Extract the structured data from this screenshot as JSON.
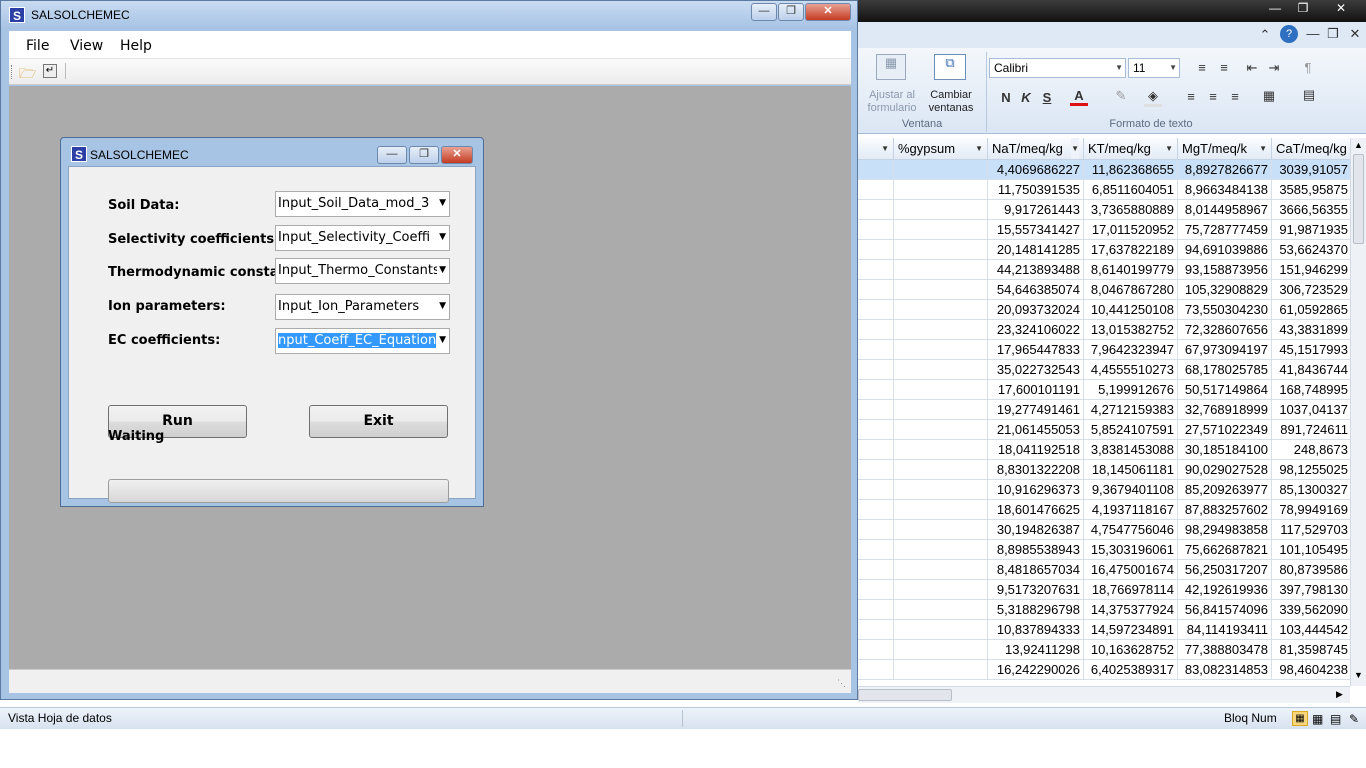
{
  "background_app": {
    "status_left": "Vista Hoja de datos",
    "status_right": "Bloq Num",
    "ribbon": {
      "ventana_group": "Ventana",
      "formato_group": "Formato de texto",
      "ajustar_label1": "Ajustar al",
      "ajustar_label2": "formulario",
      "cambiar_label1": "Cambiar",
      "cambiar_label2": "ventanas",
      "font_name": "Calibri",
      "font_size": "11",
      "bold_label": "N",
      "italic_label": "K",
      "underline_label": "S",
      "fontcolor_label": "A"
    },
    "grid": {
      "headers": [
        "%gypsum",
        "NaT/meq/kg",
        "KT/meq/kg",
        "MgT/meq/k",
        "CaT/meq/kg"
      ],
      "rows": [
        [
          "",
          "4,4069686227",
          "11,862368655",
          "8,8927826677",
          "3039,91057"
        ],
        [
          "",
          "11,750391535",
          "6,8511604051",
          "8,9663484138",
          "3585,95875"
        ],
        [
          "",
          "9,917261443",
          "3,7365880889",
          "8,0144958967",
          "3666,56355"
        ],
        [
          "",
          "15,557341427",
          "17,011520952",
          "75,728777459",
          "91,9871935"
        ],
        [
          "",
          "20,148141285",
          "17,637822189",
          "94,691039886",
          "53,6624370"
        ],
        [
          "",
          "44,213893488",
          "8,6140199779",
          "93,158873956",
          "151,946299"
        ],
        [
          "",
          "54,646385074",
          "8,0467867280",
          "105,32908829",
          "306,723529"
        ],
        [
          "",
          "20,093732024",
          "10,441250108",
          "73,550304230",
          "61,0592865"
        ],
        [
          "",
          "23,324106022",
          "13,015382752",
          "72,328607656",
          "43,3831899"
        ],
        [
          "",
          "17,965447833",
          "7,9642323947",
          "67,973094197",
          "45,1517993"
        ],
        [
          "",
          "35,022732543",
          "4,4555510273",
          "68,178025785",
          "41,8436744"
        ],
        [
          "",
          "17,600101191",
          "5,199912676",
          "50,517149864",
          "168,748995"
        ],
        [
          "",
          "19,277491461",
          "4,2712159383",
          "32,768918999",
          "1037,04137"
        ],
        [
          "",
          "21,061455053",
          "5,8524107591",
          "27,571022349",
          "891,724611"
        ],
        [
          "",
          "18,041192518",
          "3,8381453088",
          "30,185184100",
          "248,8673"
        ],
        [
          "",
          "8,8301322208",
          "18,145061181",
          "90,029027528",
          "98,1255025"
        ],
        [
          "",
          "10,916296373",
          "9,3679401108",
          "85,209263977",
          "85,1300327"
        ],
        [
          "",
          "18,601476625",
          "4,1937118167",
          "87,883257602",
          "78,9949169"
        ],
        [
          "",
          "30,194826387",
          "4,7547756046",
          "98,294983858",
          "117,529703"
        ],
        [
          "",
          "8,8985538943",
          "15,303196061",
          "75,662687821",
          "101,105495"
        ],
        [
          "",
          "8,4818657034",
          "16,475001674",
          "56,250317207",
          "80,8739586"
        ],
        [
          "",
          "9,5173207631",
          "18,766978114",
          "42,192619936",
          "397,798130"
        ],
        [
          "",
          "5,3188296798",
          "14,375377924",
          "56,841574096",
          "339,562090"
        ],
        [
          "",
          "10,837894333",
          "14,597234891",
          "84,114193411",
          "103,444542"
        ],
        [
          "",
          "13,92411298",
          "10,163628752",
          "77,388803478",
          "81,3598745"
        ],
        [
          "",
          "16,242290026",
          "6,4025389317",
          "83,082314853",
          "98,4604238"
        ]
      ]
    }
  },
  "main_window": {
    "title": "SALSOLCHEMEC",
    "menu": [
      "File",
      "View",
      "Help"
    ]
  },
  "dialog": {
    "title": "SALSOLCHEMEC",
    "fields": [
      {
        "label": "Soil Data:",
        "value": "Input_Soil_Data_mod_3"
      },
      {
        "label": "Selectivity coefficients:",
        "value": "Input_Selectivity_Coeffi"
      },
      {
        "label": "Thermodynamic constants:",
        "value": "Input_Thermo_Constants"
      },
      {
        "label": "Ion parameters:",
        "value": "Input_Ion_Parameters"
      },
      {
        "label": "EC coefficients:",
        "value": "nput_Coeff_EC_Equation"
      }
    ],
    "run_label": "Run",
    "exit_label": "Exit",
    "status": "Waiting",
    "progress": 0
  }
}
